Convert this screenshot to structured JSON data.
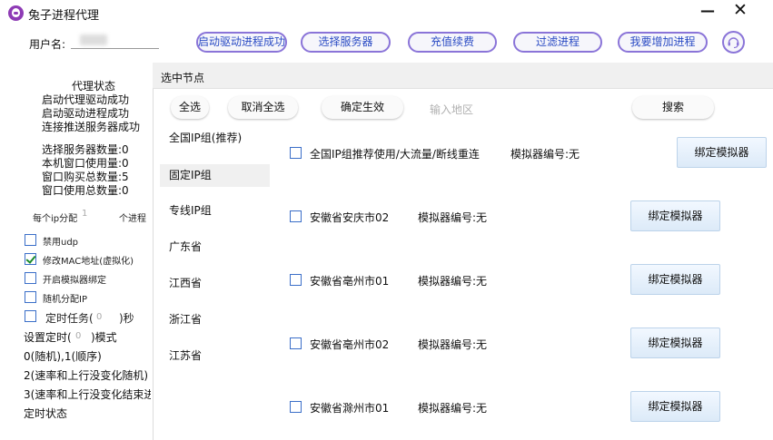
{
  "window": {
    "title": "兔子进程代理",
    "minimize": "—",
    "close": "✕"
  },
  "topbar": {
    "user_label": "用户名:",
    "buttons": [
      {
        "label": "启动驱动进程成功"
      },
      {
        "label": "选择服务器"
      },
      {
        "label": "充值续费"
      },
      {
        "label": "过滤进程"
      },
      {
        "label": "我要增加进程"
      }
    ],
    "support_icon": "headset-icon",
    "accent_color": "#8a74d8",
    "button_text_color": "#2a4bc4"
  },
  "status": {
    "title": "代理状态",
    "lines": [
      "启动代理驱动成功",
      "启动驱动进程成功",
      "连接推送服务器成功"
    ],
    "stats": [
      "选择服务器数量:0",
      "本机窗口使用量:0",
      "窗口购买总数量:5",
      "窗口使用总数量:0"
    ]
  },
  "ip_alloc": {
    "prefix": "每个ip分配",
    "value": "1",
    "suffix": "个进程"
  },
  "options": [
    {
      "label": "禁用udp",
      "checked": false
    },
    {
      "label": "修改MAC地址(虚拟化)",
      "checked": true
    },
    {
      "label": "开启模拟器绑定",
      "checked": false
    },
    {
      "label": "随机分配IP",
      "checked": false
    }
  ],
  "timer": {
    "label": "定时任务(",
    "value": "0",
    "unit": ")秒",
    "mode_label": "设置定时(",
    "mode_value": "0",
    "mode_unit": ")模式",
    "hint1": "0(随机),1(顺序)",
    "hint2": "2(速率和上行没变化随机)",
    "hint3": "3(速率和上行没变化结束进",
    "state": "定时状态"
  },
  "dialog": {
    "title": "选中节点",
    "toolbar": {
      "select_all": "全选",
      "deselect_all": "取消全选",
      "apply": "确定生效",
      "region_placeholder": "输入地区",
      "search": "搜索"
    },
    "groups": [
      {
        "label": "全国IP组(推荐)",
        "selected": false
      },
      {
        "label": "固定IP组",
        "selected": true
      },
      {
        "label": "专线IP组",
        "selected": false
      },
      {
        "label": "广东省",
        "selected": false
      },
      {
        "label": "江西省",
        "selected": false
      },
      {
        "label": "浙江省",
        "selected": false
      },
      {
        "label": "江苏省",
        "selected": false
      }
    ],
    "nodes": [
      {
        "name": "全国IP组推荐使用/大流量/断线重连",
        "sim": "模拟器编号:无",
        "bind": "绑定模拟器",
        "checked": false
      },
      {
        "name": "安徽省安庆市02",
        "sim": "模拟器编号:无",
        "bind": "绑定模拟器",
        "checked": false
      },
      {
        "name": "安徽省亳州市01",
        "sim": "模拟器编号:无",
        "bind": "绑定模拟器",
        "checked": false
      },
      {
        "name": "安徽省亳州市02",
        "sim": "模拟器编号:无",
        "bind": "绑定模拟器",
        "checked": false
      },
      {
        "name": "安徽省滁州市01",
        "sim": "模拟器编号:无",
        "bind": "绑定模拟器",
        "checked": false
      }
    ]
  }
}
